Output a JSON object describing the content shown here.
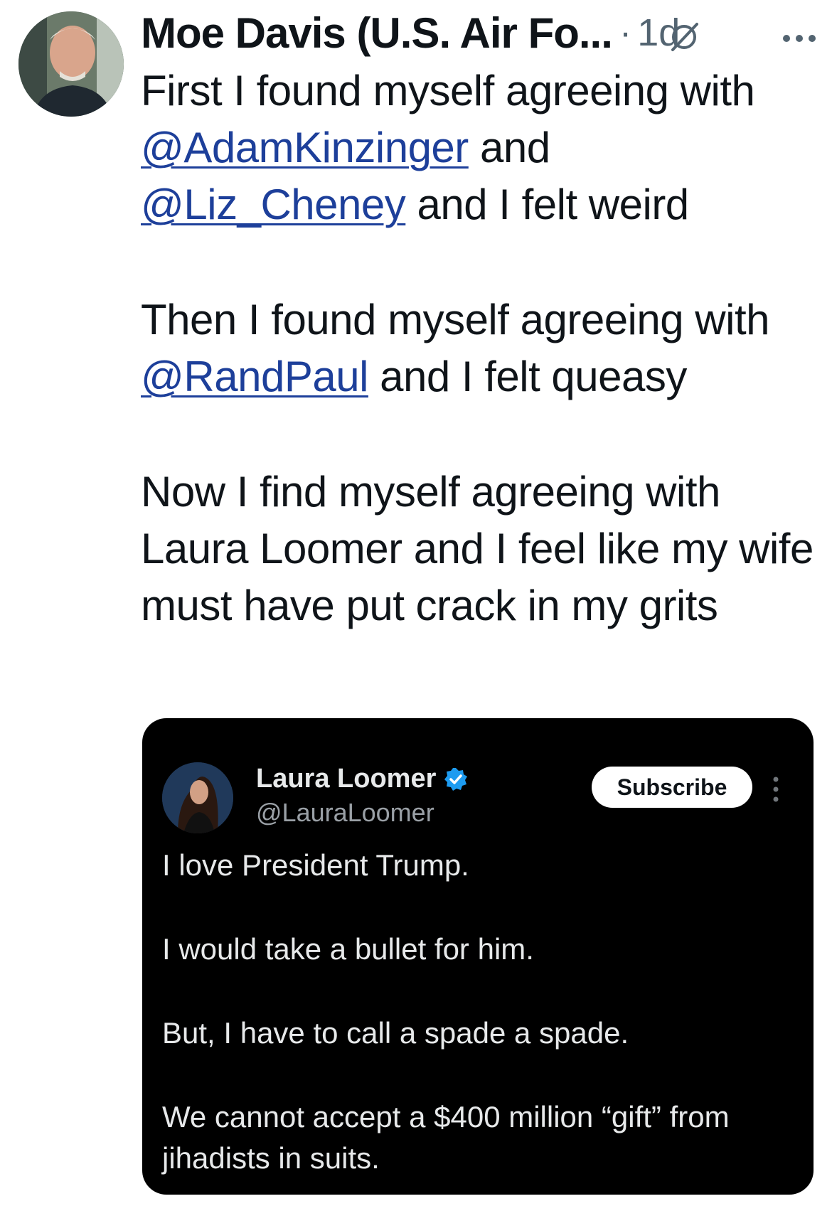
{
  "tweet": {
    "author": {
      "display_name": "Moe Davis (U.S. Air Fo...",
      "avatar_icon": "user-avatar-photo"
    },
    "separator": "·",
    "time": "1d",
    "paragraphs": [
      [
        {
          "text": "First I found myself agreeing with "
        },
        {
          "text": "@AdamKinzinger",
          "mention": true
        },
        {
          "text": " and "
        },
        {
          "text": "@Liz_Cheney",
          "mention": true
        },
        {
          "text": " and I felt weird"
        }
      ],
      [
        {
          "text": "Then I found myself agreeing with "
        },
        {
          "text": "@RandPaul",
          "mention": true
        },
        {
          "text": " and I felt queasy"
        }
      ],
      [
        {
          "text": "Now I find myself agreeing with Laura Loomer and I feel like my wife must have put crack in my grits"
        }
      ]
    ],
    "icons": {
      "edited": "slashed-circle-icon",
      "more": "more-horizontal-icon"
    }
  },
  "embedded": {
    "author": {
      "name": "Laura Loomer",
      "handle": "@LauraLoomer",
      "verified_icon": "verified-badge-icon",
      "verified_color": "#1d9bf0"
    },
    "subscribe_label": "Subscribe",
    "paragraphs": [
      "I love President Trump.",
      "I would take a bullet for him.",
      "But, I have to call a spade a spade.",
      "We cannot accept a $400 million “gift” from jihadists in suits."
    ]
  },
  "colors": {
    "mention": "#1d3f9a",
    "text": "#0f1419",
    "secondary": "#536471",
    "embed_bg": "#000000"
  }
}
